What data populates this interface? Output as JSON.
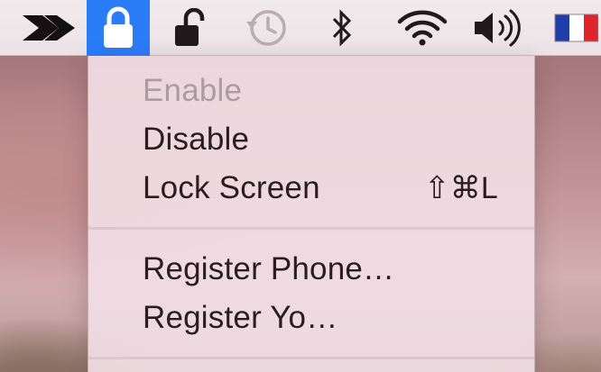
{
  "menubar": {
    "icons": {
      "app": "arrow-feather-icon",
      "lock_active": "lock-closed-icon",
      "lock_open": "lock-open-icon",
      "time_machine": "time-machine-icon",
      "bluetooth": "bluetooth-icon",
      "wifi": "wifi-icon",
      "volume": "volume-icon",
      "input_source": "french-flag-icon"
    },
    "active_color": "#2b7cf7"
  },
  "menu": {
    "items": [
      {
        "label": "Enable",
        "enabled": false
      },
      {
        "label": "Disable",
        "enabled": true
      },
      {
        "label": "Lock Screen",
        "shortcut": "⇧⌘L",
        "enabled": true
      },
      {
        "label": "Register Phone…",
        "enabled": true
      },
      {
        "label": "Register Yo…",
        "enabled": true
      }
    ]
  }
}
